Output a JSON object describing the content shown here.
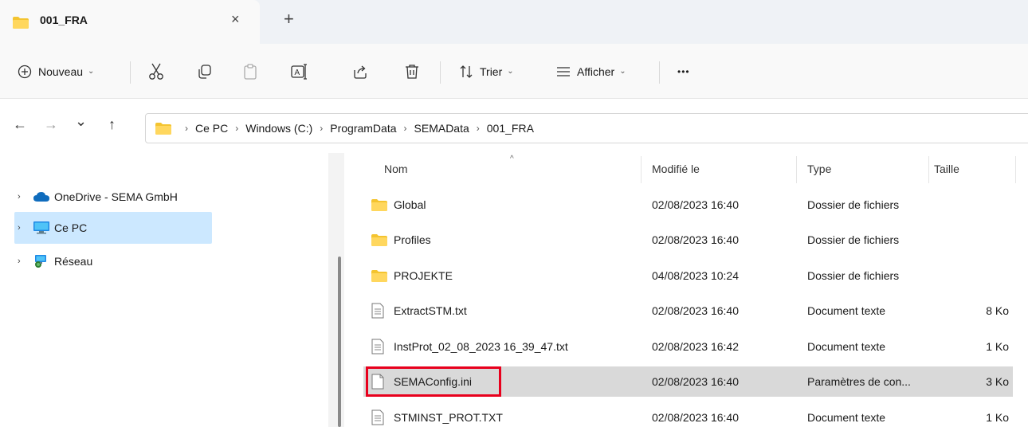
{
  "tab": {
    "title": "001_FRA",
    "close_glyph": "×",
    "new_tab_glyph": "+"
  },
  "toolbar": {
    "new_label": "Nouveau",
    "sort_label": "Trier",
    "view_label": "Afficher",
    "more_glyph": "•••"
  },
  "nav": {
    "back_glyph": "←",
    "forward_glyph": "→",
    "recent_glyph": "⌄",
    "up_glyph": "↑"
  },
  "address": {
    "crumbs": [
      "Ce PC",
      "Windows (C:)",
      "ProgramData",
      "SEMAData",
      "001_FRA"
    ],
    "sep": "›"
  },
  "sidebar": {
    "items": [
      {
        "label": "OneDrive - SEMA GmbH",
        "expander": "›"
      },
      {
        "label": "Ce PC",
        "expander": "›"
      },
      {
        "label": "Réseau",
        "expander": "›"
      }
    ]
  },
  "columns": {
    "name": "Nom",
    "modified": "Modifié le",
    "type": "Type",
    "size": "Taille",
    "sort_caret": "^"
  },
  "files": [
    {
      "name": "Global",
      "modified": "02/08/2023 16:40",
      "type": "Dossier de fichiers",
      "size": "",
      "kind": "folder"
    },
    {
      "name": "Profiles",
      "modified": "02/08/2023 16:40",
      "type": "Dossier de fichiers",
      "size": "",
      "kind": "folder"
    },
    {
      "name": "PROJEKTE",
      "modified": "04/08/2023 10:24",
      "type": "Dossier de fichiers",
      "size": "",
      "kind": "folder"
    },
    {
      "name": "ExtractSTM.txt",
      "modified": "02/08/2023 16:40",
      "type": "Document texte",
      "size": "8 Ko",
      "kind": "text"
    },
    {
      "name": "InstProt_02_08_2023 16_39_47.txt",
      "modified": "02/08/2023 16:42",
      "type": "Document texte",
      "size": "1 Ko",
      "kind": "text"
    },
    {
      "name": "SEMAConfig.ini",
      "modified": "02/08/2023 16:40",
      "type": "Paramètres de con...",
      "size": "3 Ko",
      "kind": "ini"
    },
    {
      "name": "STMINST_PROT.TXT",
      "modified": "02/08/2023 16:40",
      "type": "Document texte",
      "size": "1 Ko",
      "kind": "text"
    }
  ],
  "colors": {
    "folder": "#f4c430",
    "selection": "#cce8ff",
    "row_selected": "#d9d9d9",
    "highlight": "#e8001d",
    "onedrive": "#0f6cbd"
  }
}
